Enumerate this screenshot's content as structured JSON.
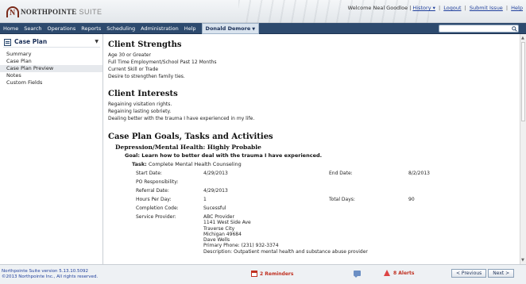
{
  "header": {
    "logo_name": "NORTHPOINTE",
    "logo_suffix": "SUITE",
    "welcome": "Welcome Neal Goodloe |",
    "history": "History ▾",
    "logout": "Logout",
    "submit_issue": "Submit Issue",
    "help": "Help"
  },
  "nav": {
    "items": [
      "Home",
      "Search",
      "Operations",
      "Reports",
      "Scheduling",
      "Administration",
      "Help"
    ],
    "active_client": "Donald Demore",
    "search_placeholder": ""
  },
  "sidebar": {
    "title": "Case Plan",
    "items": [
      "Summary",
      "Case Plan",
      "Case Plan Preview",
      "Notes",
      "Custom Fields"
    ],
    "active_index": 2
  },
  "main": {
    "strengths_title": "Client Strengths",
    "strengths": [
      "Age 30 or Greater",
      "Full Time Employment/School Past 12 Months",
      "Current Skill or Trade",
      "Desire to strengthen family ties."
    ],
    "interests_title": "Client Interests",
    "interests": [
      "Regaining visitation rights.",
      "Regaining lasting sobriety.",
      "Dealing better with the trauma I have experienced in my life."
    ],
    "goals_title": "Case Plan Goals, Tasks and Activities",
    "need": "Depression/Mental Health: Highly Probable",
    "goal": "Goal: Learn how to better deal with the trauma I have experienced.",
    "task_label": "Task:",
    "task_value": "Complete Mental Health Counseling",
    "fields": {
      "start_date_label": "Start Date:",
      "start_date": "4/29/2013",
      "end_date_label": "End Date:",
      "end_date": "8/2/2013",
      "po_label": "PO Responsibility:",
      "referral_label": "Referral Date:",
      "referral_date": "4/29/2013",
      "hours_label": "Hours Per Day:",
      "hours": "1",
      "total_days_label": "Total Days:",
      "total_days": "90",
      "completion_label": "Completion Code:",
      "completion": "Sucessful",
      "provider_label": "Service Provider:",
      "provider_lines": [
        "ABC Provider",
        "1141 West Side Ave",
        "Traverse City",
        "Michigan 49684",
        "Dave Wells",
        "Primary Phone: (231) 932-3374",
        "Description: Outpatient mental health and substance abuse provider"
      ]
    }
  },
  "footer": {
    "version": "Northpointe Suite version 5.13.10.5092",
    "copyright": "©2013 Northpointe Inc., All rights reserved.",
    "reminders": "2 Reminders",
    "alerts": "8 Alerts",
    "previous": "< Previous",
    "next": "Next >"
  },
  "colors": {
    "nav_bg": "#2d4a6e",
    "alert_red": "#c03020",
    "link_blue": "#1f3f9c"
  }
}
